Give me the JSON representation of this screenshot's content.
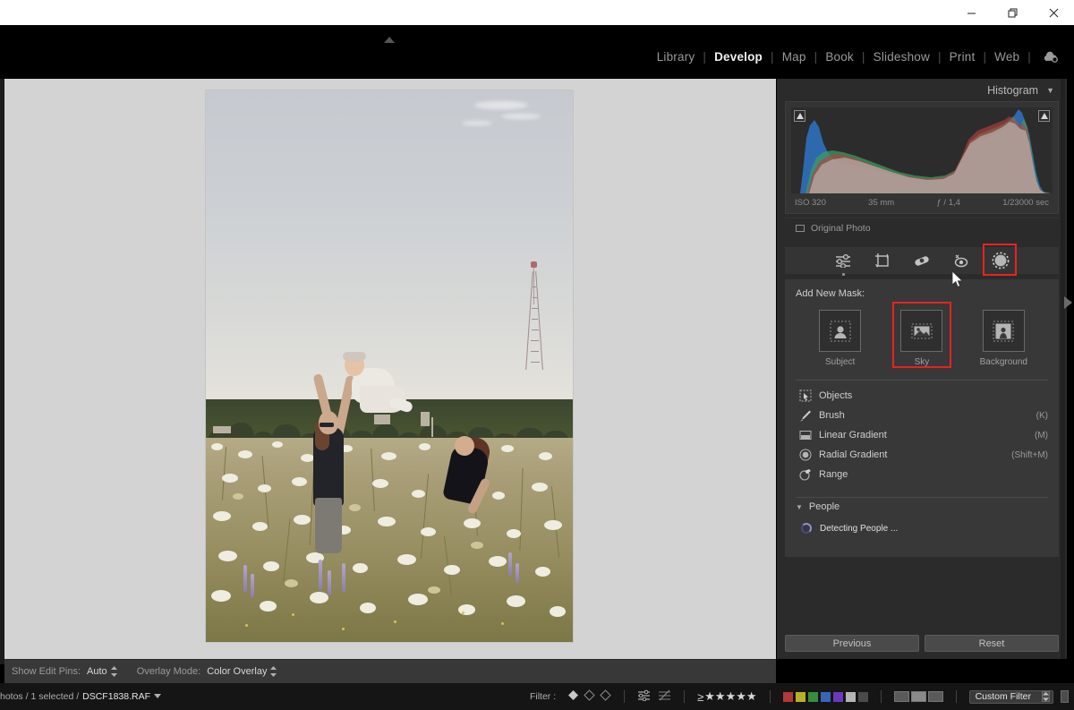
{
  "window": {
    "controls": [
      {
        "name": "minimize",
        "glyph": "minimize-icon"
      },
      {
        "name": "restore",
        "glyph": "restore-icon"
      },
      {
        "name": "close",
        "glyph": "close-icon"
      }
    ]
  },
  "module_nav": {
    "items": [
      {
        "label": "Library",
        "active": false
      },
      {
        "label": "Develop",
        "active": true
      },
      {
        "label": "Map",
        "active": false
      },
      {
        "label": "Book",
        "active": false
      },
      {
        "label": "Slideshow",
        "active": false
      },
      {
        "label": "Print",
        "active": false
      },
      {
        "label": "Web",
        "active": false
      }
    ],
    "cloud_icon": "cloud-sync-icon"
  },
  "histogram": {
    "title": "Histogram",
    "disclosure": "▼",
    "iso": "ISO 320",
    "focal_length": "35 mm",
    "aperture": "ƒ / 1,4",
    "shutter": "1/23000 sec",
    "original_photo_label": "Original Photo"
  },
  "tool_strip": {
    "tools": [
      {
        "name": "basic-adjustments",
        "icon": "sliders-icon",
        "selected_dot": true,
        "highlighted": false
      },
      {
        "name": "crop-overlay",
        "icon": "crop-icon",
        "selected_dot": false,
        "highlighted": false
      },
      {
        "name": "healing-brush",
        "icon": "bandage-icon",
        "selected_dot": false,
        "highlighted": false
      },
      {
        "name": "red-eye",
        "icon": "red-eye-icon",
        "selected_dot": false,
        "highlighted": false
      },
      {
        "name": "masking",
        "icon": "masking-circle-icon",
        "selected_dot": false,
        "highlighted": true
      }
    ]
  },
  "mask_panel": {
    "add_new_mask_label": "Add New Mask:",
    "presets": [
      {
        "label": "Subject",
        "icon": "subject-person-icon",
        "highlighted": false
      },
      {
        "label": "Sky",
        "icon": "sky-landscape-icon",
        "highlighted": true
      },
      {
        "label": "Background",
        "icon": "background-icon",
        "highlighted": false
      }
    ],
    "tools": [
      {
        "label": "Objects",
        "shortcut": "",
        "icon": "objects-icon"
      },
      {
        "label": "Brush",
        "shortcut": "(K)",
        "icon": "brush-icon"
      },
      {
        "label": "Linear Gradient",
        "shortcut": "(M)",
        "icon": "linear-gradient-icon"
      },
      {
        "label": "Radial Gradient",
        "shortcut": "(Shift+M)",
        "icon": "radial-gradient-icon"
      },
      {
        "label": "Range",
        "shortcut": "",
        "icon": "range-icon"
      }
    ],
    "people": {
      "title": "People",
      "disclosure": "▼",
      "status": "Detecting People ..."
    }
  },
  "panel_buttons": {
    "previous": "Previous",
    "reset": "Reset"
  },
  "canvas_toolbar": {
    "show_edit_pins_label": "Show Edit Pins:",
    "show_edit_pins_value": "Auto",
    "overlay_mode_label": "Overlay Mode:",
    "overlay_mode_value": "Color Overlay"
  },
  "status_bar": {
    "photos_text": "hotos / 1 selected /",
    "filename": "DSCF1838.RAF",
    "filter_label": "Filter :",
    "rating_operator": "≥",
    "stars": "★★★★★",
    "color_labels": [
      "#b03a3a",
      "#b8b028",
      "#3a8c3a",
      "#3a64b8",
      "#6a3ab8",
      "#b4b4b4",
      "#4a4a4a"
    ],
    "custom_filter": "Custom Filter"
  },
  "photo": {
    "alt_description": "Man tossing a baby in the air in a flowering summer meadow with a radio tower on the horizon"
  }
}
